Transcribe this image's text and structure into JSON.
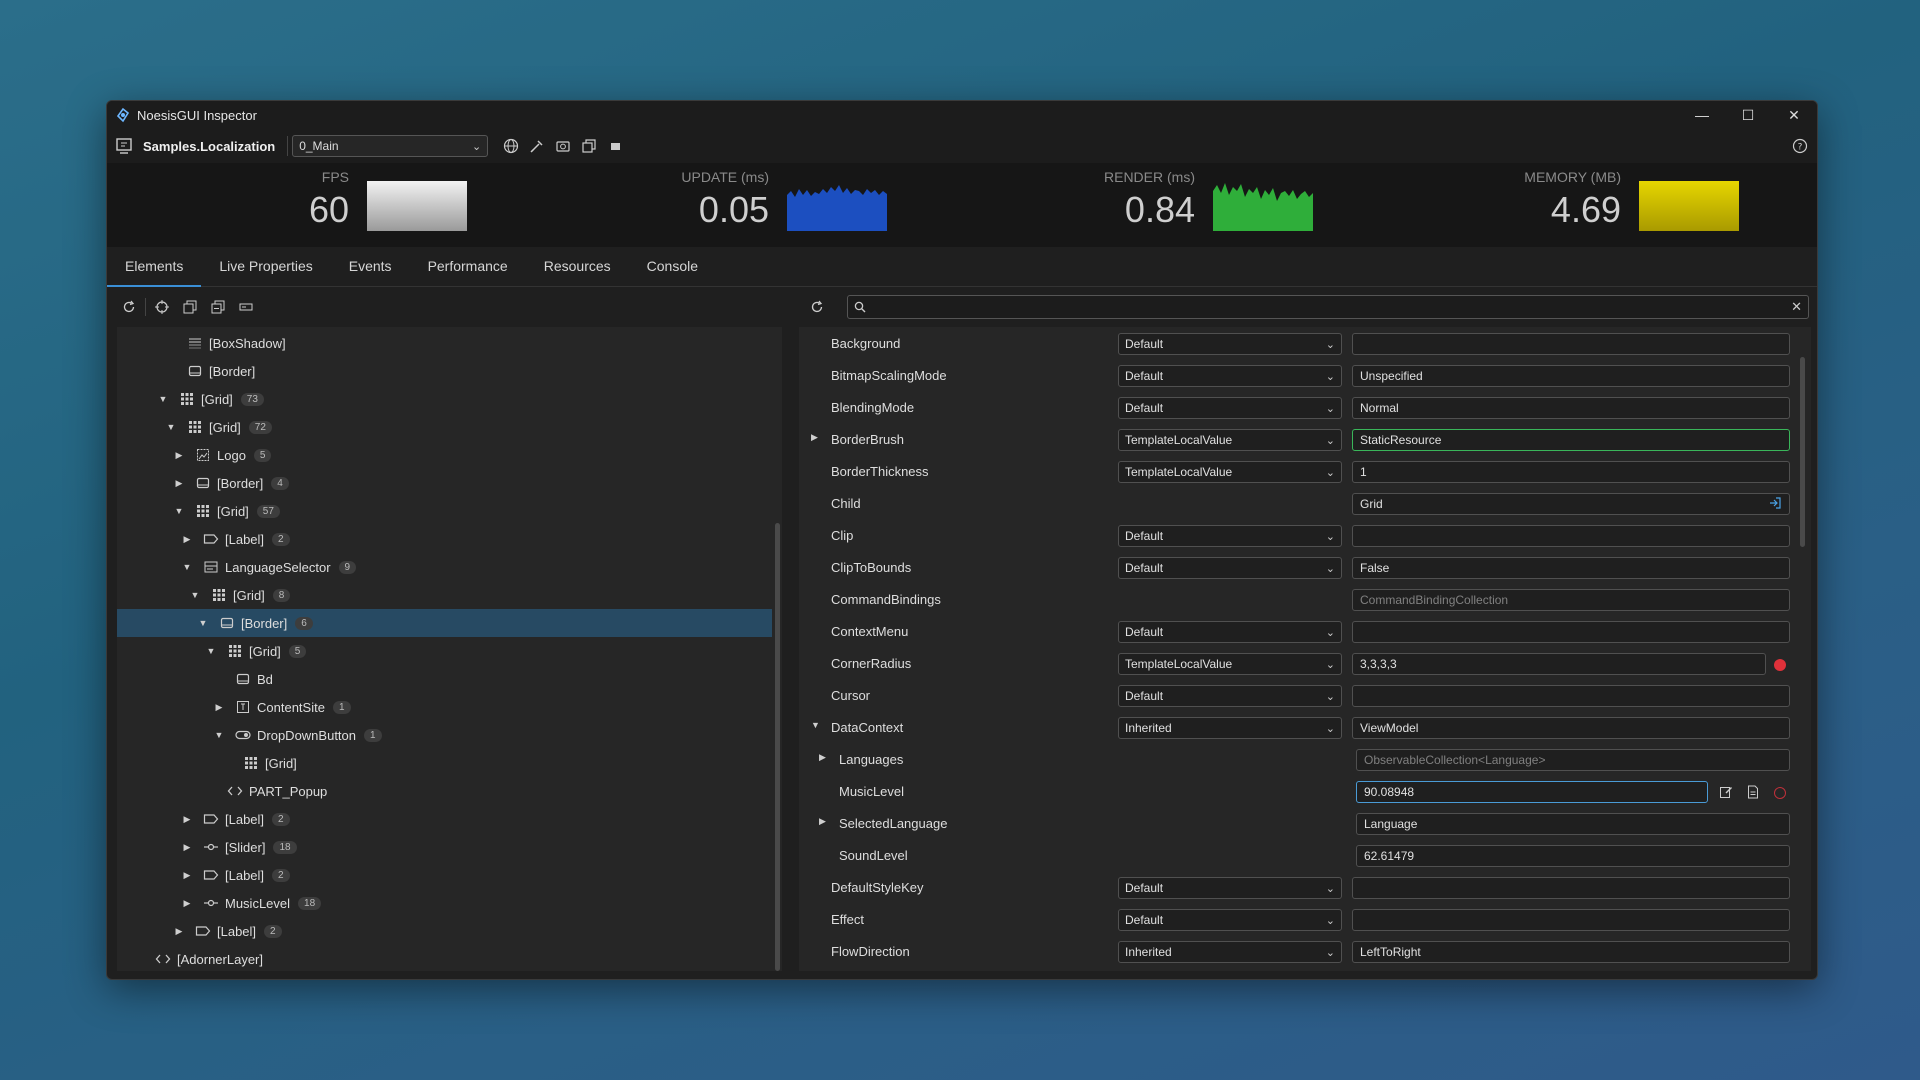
{
  "window": {
    "title": "NoesisGUI Inspector"
  },
  "toolbar": {
    "project": "Samples.Localization",
    "view": "0_Main"
  },
  "stats": {
    "fps": {
      "label": "FPS",
      "value": "60"
    },
    "update": {
      "label": "UPDATE (ms)",
      "value": "0.05"
    },
    "render": {
      "label": "RENDER (ms)",
      "value": "0.84"
    },
    "memory": {
      "label": "MEMORY (MB)",
      "value": "4.69"
    }
  },
  "colors": {
    "accent": "#3a8fd6",
    "update_graph": "#1c55c8",
    "render_graph": "#2fae3a",
    "memory_graph": "#d8c400",
    "fps_graph": "#d0d0d0"
  },
  "tabs": [
    "Elements",
    "Live Properties",
    "Events",
    "Performance",
    "Resources",
    "Console"
  ],
  "tree": [
    {
      "label": "[BoxShadow]",
      "icon": "boxshadow-icon",
      "level": 5,
      "arrow": ""
    },
    {
      "label": "[Border]",
      "icon": "border-icon",
      "level": 5,
      "arrow": ""
    },
    {
      "label": "[Grid]",
      "icon": "grid-icon",
      "level": 4,
      "arrow": "down",
      "count": "73"
    },
    {
      "label": "[Grid]",
      "icon": "grid-icon",
      "level": 5,
      "arrow": "down",
      "count": "72"
    },
    {
      "label": "Logo",
      "icon": "image-icon",
      "level": 6,
      "arrow": "right",
      "count": "5"
    },
    {
      "label": "[Border]",
      "icon": "border-icon",
      "level": 6,
      "arrow": "right",
      "count": "4"
    },
    {
      "label": "[Grid]",
      "icon": "grid-icon",
      "level": 6,
      "arrow": "down",
      "count": "57"
    },
    {
      "label": "[Label]",
      "icon": "label-icon",
      "level": 7,
      "arrow": "right",
      "count": "2"
    },
    {
      "label": "LanguageSelector",
      "icon": "combobox-icon",
      "level": 7,
      "arrow": "down",
      "count": "9"
    },
    {
      "label": "[Grid]",
      "icon": "grid-icon",
      "level": 8,
      "arrow": "down",
      "count": "8"
    },
    {
      "label": "[Border]",
      "icon": "border-icon",
      "level": 9,
      "arrow": "down",
      "count": "6",
      "selected": true
    },
    {
      "label": "[Grid]",
      "icon": "grid-icon",
      "level": 10,
      "arrow": "down",
      "count": "5"
    },
    {
      "label": "Bd",
      "icon": "border-icon",
      "level": 11,
      "arrow": ""
    },
    {
      "label": "ContentSite",
      "icon": "content-icon",
      "level": 11,
      "arrow": "right",
      "count": "1"
    },
    {
      "label": "DropDownButton",
      "icon": "toggle-icon",
      "level": 11,
      "arrow": "down",
      "count": "1"
    },
    {
      "label": "[Grid]",
      "icon": "grid-icon",
      "level": 12,
      "arrow": ""
    },
    {
      "label": "PART_Popup",
      "icon": "code-icon",
      "level": 10,
      "arrow": ""
    },
    {
      "label": "[Label]",
      "icon": "label-icon",
      "level": 7,
      "arrow": "right",
      "count": "2"
    },
    {
      "label": "[Slider]",
      "icon": "slider-icon",
      "level": 7,
      "arrow": "right",
      "count": "18"
    },
    {
      "label": "[Label]",
      "icon": "label-icon",
      "level": 7,
      "arrow": "right",
      "count": "2"
    },
    {
      "label": "MusicLevel",
      "icon": "slider-icon",
      "level": 7,
      "arrow": "right",
      "count": "18"
    },
    {
      "label": "[Label]",
      "icon": "label-icon",
      "level": 6,
      "arrow": "right",
      "count": "2"
    },
    {
      "label": "[AdornerLayer]",
      "icon": "code-icon",
      "level": 1,
      "arrow": ""
    }
  ],
  "search": {
    "placeholder": ""
  },
  "properties": [
    {
      "name": "Background",
      "source": "Default",
      "value": ""
    },
    {
      "name": "BitmapScalingMode",
      "source": "Default",
      "value": "Unspecified"
    },
    {
      "name": "BlendingMode",
      "source": "Default",
      "value": "Normal"
    },
    {
      "name": "BorderBrush",
      "source": "TemplateLocalValue",
      "value": "StaticResource",
      "arrow": "right",
      "highlight": "green"
    },
    {
      "name": "BorderThickness",
      "source": "TemplateLocalValue",
      "value": "1"
    },
    {
      "name": "Child",
      "value": "Grid",
      "nav": true
    },
    {
      "name": "Clip",
      "source": "Default",
      "value": ""
    },
    {
      "name": "ClipToBounds",
      "source": "Default",
      "value": "False"
    },
    {
      "name": "CommandBindings",
      "value": "CommandBindingCollection",
      "placeholder": true
    },
    {
      "name": "ContextMenu",
      "source": "Default",
      "value": ""
    },
    {
      "name": "CornerRadius",
      "source": "TemplateLocalValue",
      "value": "3,3,3,3",
      "dot": true
    },
    {
      "name": "Cursor",
      "source": "Default",
      "value": ""
    },
    {
      "name": "DataContext",
      "source": "Inherited",
      "value": "ViewModel",
      "arrow": "down"
    },
    {
      "name": "Languages",
      "value": "ObservableCollection<Language>",
      "placeholder": true,
      "arrow": "right",
      "sub": true
    },
    {
      "name": "MusicLevel",
      "value": "90.08948",
      "sub": true,
      "edit": true
    },
    {
      "name": "SelectedLanguage",
      "value": "Language",
      "arrow": "right",
      "sub": true
    },
    {
      "name": "SoundLevel",
      "value": "62.61479",
      "sub": true
    },
    {
      "name": "DefaultStyleKey",
      "source": "Default",
      "value": ""
    },
    {
      "name": "Effect",
      "source": "Default",
      "value": ""
    },
    {
      "name": "FlowDirection",
      "source": "Inherited",
      "value": "LeftToRight"
    }
  ]
}
